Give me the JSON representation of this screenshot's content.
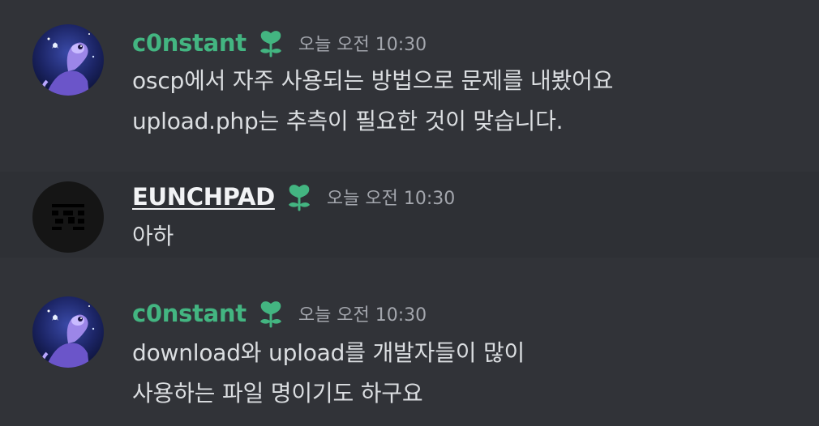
{
  "colors": {
    "background": "#313338",
    "hover_background": "#2e3035",
    "username_green": "#43b581",
    "username_white": "#f2f3f5",
    "timestamp": "#a3a6ad",
    "message_text": "#dbdee1"
  },
  "messages": [
    {
      "author": "c0nstant",
      "role_icon": "sprout-icon",
      "timestamp": "오늘 오전 10:30",
      "lines": [
        "oscp에서 자주 사용되는 방법으로 문제를 내봤어요",
        "upload.php는 추측이 필요한 것이 맞습니다."
      ]
    },
    {
      "author": "EUNCHPAD",
      "role_icon": "sprout-icon",
      "timestamp": "오늘 오전 10:30",
      "lines": [
        "아하"
      ]
    },
    {
      "author": "c0nstant",
      "role_icon": "sprout-icon",
      "timestamp": "오늘 오전 10:30",
      "lines": [
        "download와 upload를 개발자들이 많이",
        "사용하는 파일 명이기도 하구요"
      ]
    }
  ]
}
